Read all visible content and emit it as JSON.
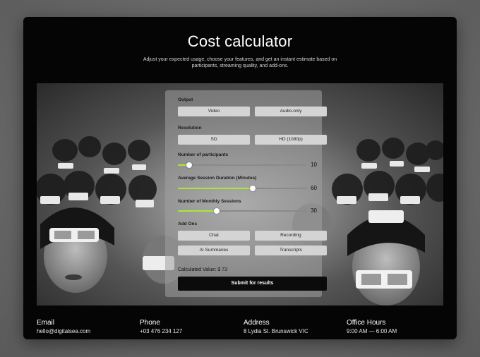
{
  "header": {
    "title": "Cost calculator",
    "subtitle": "Adjust your expected usage, choose your features, and get an instant estimate based on participants, streaming quality, and add-ons."
  },
  "calculator": {
    "output": {
      "label": "Output",
      "options": [
        "Video",
        "Audio-only"
      ]
    },
    "resolution": {
      "label": "Resolution",
      "options": [
        "SD",
        "HD (1080p)"
      ]
    },
    "participants": {
      "label": "Number of participants",
      "value": "10",
      "level": 0.09
    },
    "duration": {
      "label": "Average Session Duration (Minutes)",
      "value": "60",
      "level": 0.58
    },
    "sessions": {
      "label": "Number of Monthly Sessions",
      "value": "30",
      "level": 0.3
    },
    "addons": {
      "label": "Add Ons",
      "options": [
        "Chat",
        "Recording",
        "AI Summaries",
        "Transcripts"
      ]
    },
    "calculated": "Calculated Value: $ 73",
    "submit": "Submit for results",
    "accent": "#a8e830"
  },
  "footer": {
    "email": {
      "label": "Email",
      "value": "hello@digitalsea.com"
    },
    "phone": {
      "label": "Phone",
      "value": "+03 476 234 127"
    },
    "address": {
      "label": "Address",
      "value": "8 Lydia St. Brunswick VIC"
    },
    "hours": {
      "label": "Office Hours",
      "value": "9:00 AM — 6:00 AM"
    }
  }
}
